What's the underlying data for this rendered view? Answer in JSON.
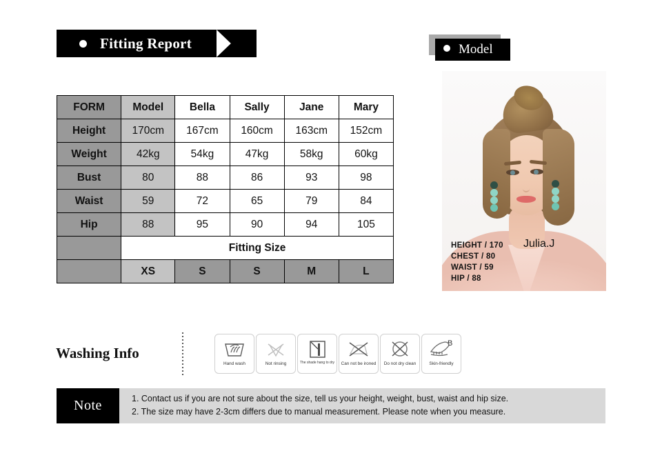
{
  "fitting_report": {
    "title": "Fitting Report",
    "dot_icon": "bullet-dot-icon"
  },
  "model_banner": {
    "title": "Model",
    "dot_icon": "bullet-dot-icon"
  },
  "size_table": {
    "columns": [
      "FORM",
      "Model",
      "Bella",
      "Sally",
      "Jane",
      "Mary"
    ],
    "rows": [
      {
        "label": "Height",
        "values": [
          "170cm",
          "167cm",
          "160cm",
          "163cm",
          "152cm"
        ]
      },
      {
        "label": "Weight",
        "values": [
          "42kg",
          "54kg",
          "47kg",
          "58kg",
          "60kg"
        ]
      },
      {
        "label": "Bust",
        "values": [
          "80",
          "88",
          "86",
          "93",
          "98"
        ]
      },
      {
        "label": "Waist",
        "values": [
          "59",
          "72",
          "65",
          "79",
          "84"
        ]
      },
      {
        "label": "Hip",
        "values": [
          "88",
          "95",
          "90",
          "94",
          "105"
        ]
      }
    ],
    "fitting_size_label": "Fitting Size",
    "sizes": [
      "XS",
      "S",
      "S",
      "M",
      "L"
    ],
    "colors": {
      "header_gray": "#999999",
      "model_gray": "#c3c3c3",
      "border": "#000000"
    }
  },
  "model_photo": {
    "name": "Julia.J",
    "stats": [
      "HEIGHT /  170",
      "CHEST /  80",
      "WAIST /  59",
      "HIP /  88"
    ]
  },
  "washing_info": {
    "title": "Washing Info",
    "icons": [
      {
        "icon": "hand-wash-icon",
        "caption": "Hand wash"
      },
      {
        "icon": "not-rinsing-icon",
        "caption": "Not rinsing"
      },
      {
        "icon": "shade-hang-to-dry-icon",
        "caption": "The shade hang to dry"
      },
      {
        "icon": "do-not-iron-icon",
        "caption": "Can not be ironed"
      },
      {
        "icon": "do-not-dry-clean-icon",
        "caption": "Do not dry clean"
      },
      {
        "icon": "skin-friendly-icon",
        "caption": "Skin-friendly",
        "badge": "B"
      }
    ]
  },
  "note": {
    "badge": "Note",
    "lines": [
      "1. Contact us if you are not sure about the size, tell us your height, weight, bust, waist and hip size.",
      "2. The size may have 2-3cm differs due to manual measurement. Please note when you measure."
    ]
  }
}
